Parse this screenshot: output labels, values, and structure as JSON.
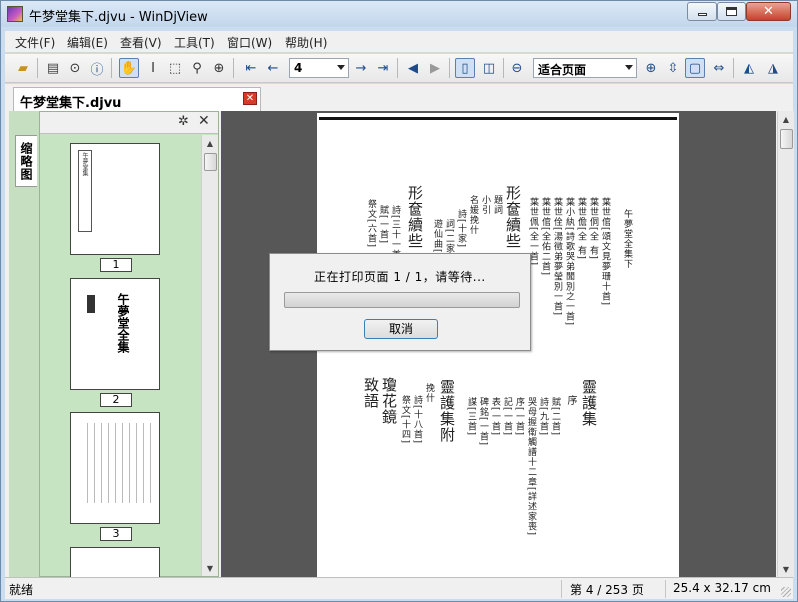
{
  "window": {
    "title": "午梦堂集下.djvu - WinDjView",
    "minimize_glyph": "",
    "close_glyph": "✕"
  },
  "menu": [
    "文件(F)",
    "编辑(E)",
    "查看(V)",
    "工具(T)",
    "窗口(W)",
    "帮助(H)"
  ],
  "toolbar": {
    "page_number": "4",
    "zoom": "适合页面",
    "icons": [
      "open-icon",
      "print-icon",
      "find-icon",
      "info-icon",
      "hand-tool-icon",
      "select-text-icon",
      "select-area-icon",
      "zoom-rect-icon",
      "magnify-icon",
      "first-page-icon",
      "prev-page-icon",
      "next-page-icon",
      "last-page-icon",
      "back-icon",
      "forward-icon",
      "single-page-icon",
      "facing-pages-icon",
      "zoom-out-icon",
      "zoom-in-icon",
      "fit-page-icon",
      "actual-size-icon",
      "fit-width-icon",
      "rotate-left-icon",
      "rotate-right-icon"
    ]
  },
  "document_tab": {
    "label": "午梦堂集下.djvu",
    "close_glyph": "✕"
  },
  "side_panel": {
    "tab_label": "缩略图",
    "thumbnails": [
      {
        "page": "1"
      },
      {
        "page": "2"
      },
      {
        "page": "3"
      }
    ]
  },
  "page_content": {
    "columns": [
      "午夢堂全集下",
      "葉世倌[頌文見夢珊十首]",
      "葉世侗[全 有]",
      "葉世儋[全 有]",
      "葉小紈[詩歌哭弟聞別之一首]",
      "葉世佺[湯徵弟夢瑩別一首]",
      "葉世倌[全佑二首]",
      "葉世佩[全一首]",
      "形奩續些",
      "題詞",
      "小引",
      "名媛挽什",
      "詩[十家]",
      "詞[二家]",
      "遊仙曲[十二首]",
      "形奩續些",
      "詩[三十一首]",
      "賦[一首]",
      "祭文[六首]",
      "靈護集",
      "序",
      "賦[二首]",
      "詩[九首]",
      "哭母握衛觸譜十二章[詳述家喪]",
      "序[一首]",
      "記[一首]",
      "表[一首]",
      "碑銘[一首]",
      "謀[三首]",
      "靈護集附",
      "挽什",
      "詩[十八首]",
      "祭文[十四]",
      "瓊花鏡",
      "致語"
    ]
  },
  "dialog": {
    "message": "正在打印页面 1 / 1，请等待...",
    "progress": 0.0,
    "cancel_label": "取消"
  },
  "status": {
    "left": "就绪",
    "page": "第 4 / 253 页",
    "size": "25.4 x 32.17 cm"
  }
}
